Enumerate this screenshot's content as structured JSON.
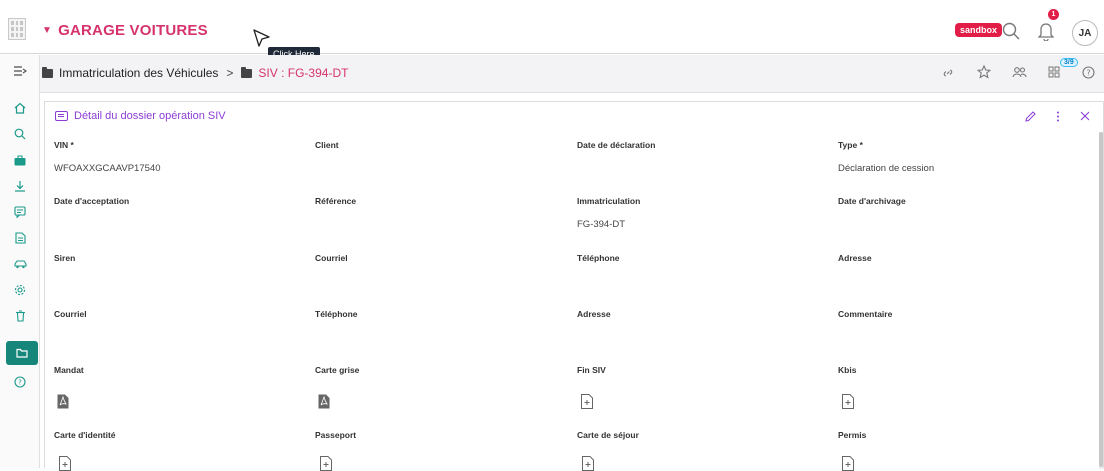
{
  "topbar": {
    "brand": "GARAGE VOITURES",
    "tooltip": "Click Here",
    "env_badge": "sandbox",
    "notification_count": "1",
    "avatar_initials": "JA"
  },
  "sidebar": {
    "items": [
      {
        "name": "home-icon",
        "glyph": "⌂"
      },
      {
        "name": "search-icon",
        "glyph": "⚲"
      },
      {
        "name": "briefcase-icon",
        "glyph": "▬"
      },
      {
        "name": "download-icon",
        "glyph": "⤓"
      },
      {
        "name": "message-icon",
        "glyph": "▤"
      },
      {
        "name": "document-icon",
        "glyph": "▦"
      },
      {
        "name": "car-icon",
        "glyph": "⛟"
      },
      {
        "name": "settings-icon",
        "glyph": "⚙"
      },
      {
        "name": "trash-icon",
        "glyph": "🗑"
      },
      {
        "name": "folder-icon",
        "glyph": "▭"
      },
      {
        "name": "help-icon",
        "glyph": "?"
      }
    ]
  },
  "breadcrumb": {
    "parent": "Immatriculation des Véhicules",
    "separator": ">",
    "current": "SIV : FG-394-DT",
    "counter": "3/9"
  },
  "panel": {
    "title": "Détail du dossier opération SIV"
  },
  "fields": {
    "vin_label": "VIN *",
    "vin_value": "WFOAXXGCAAVP17540",
    "client_label": "Client",
    "date_declaration_label": "Date de déclaration",
    "type_label": "Type *",
    "type_value": "Déclaration de cession",
    "date_acceptation_label": "Date d'acceptation",
    "reference_label": "Référence",
    "immatriculation_label": "Immatriculation",
    "immatriculation_value": "FG-394-DT",
    "date_archivage_label": "Date d'archivage",
    "siren_label": "Siren",
    "courriel_label_1": "Courriel",
    "telephone_label_1": "Téléphone",
    "adresse_label_1": "Adresse",
    "courriel_label_2": "Courriel",
    "telephone_label_2": "Téléphone",
    "adresse_label_2": "Adresse",
    "commentaire_label": "Commentaire",
    "mandat_label": "Mandat",
    "carte_grise_label": "Carte grise",
    "fin_siv_label": "Fin SIV",
    "kbis_label": "Kbis",
    "carte_identite_label": "Carte d'identité",
    "passeport_label": "Passeport",
    "carte_sejour_label": "Carte de séjour",
    "permis_label": "Permis"
  },
  "colors": {
    "brand": "#d6336c",
    "accent_teal": "#16867a",
    "panel_purple": "#8b3dd6",
    "badge_red": "#e11d48"
  }
}
